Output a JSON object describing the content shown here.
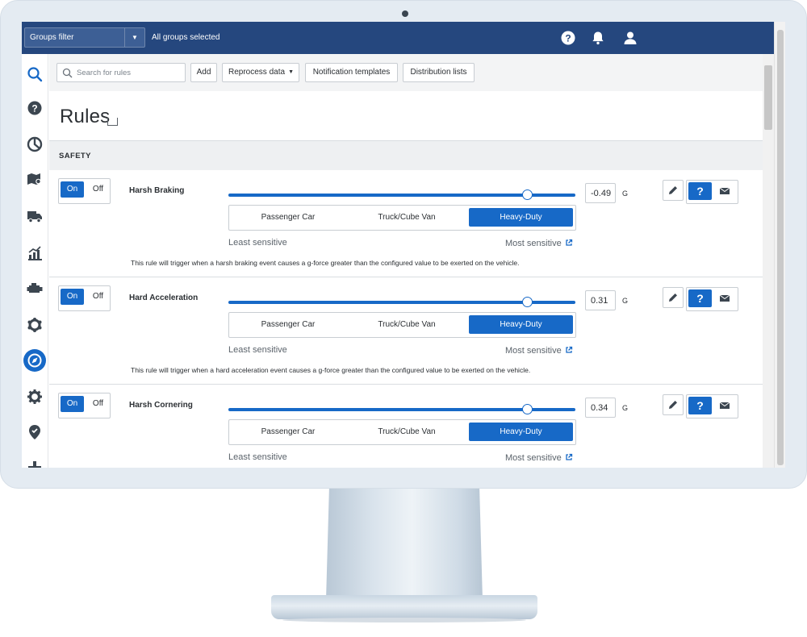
{
  "header": {
    "groups_filter_label": "Groups filter",
    "groups_status": "All groups selected"
  },
  "toolbar": {
    "search_placeholder": "Search for rules",
    "add_label": "Add",
    "reprocess_label": "Reprocess data",
    "notification_templates_label": "Notification templates",
    "distribution_lists_label": "Distribution lists"
  },
  "page": {
    "title": "Rules",
    "section_label": "SAFETY"
  },
  "vehicle_types": [
    "Passenger Car",
    "Truck/Cube Van",
    "Heavy-Duty"
  ],
  "sensitivity": {
    "least_label": "Least sensitive",
    "most_label": "Most sensitive"
  },
  "rules": [
    {
      "name": "Harsh Braking",
      "on_label": "On",
      "off_label": "Off",
      "enabled": true,
      "value": "-0.49",
      "unit": "G",
      "selected_vehicle": "Heavy-Duty",
      "slider_fraction": 0.86,
      "description": "This rule will trigger when a harsh braking event causes a g-force greater than the configured value to be exerted on the vehicle."
    },
    {
      "name": "Hard Acceleration",
      "on_label": "On",
      "off_label": "Off",
      "enabled": true,
      "value": "0.31",
      "unit": "G",
      "selected_vehicle": "Heavy-Duty",
      "slider_fraction": 0.86,
      "description": "This rule will trigger when a hard acceleration event causes a g-force greater than the configured value to be exerted on the vehicle."
    },
    {
      "name": "Harsh Cornering",
      "on_label": "On",
      "off_label": "Off",
      "enabled": true,
      "value": "0.34",
      "unit": "G",
      "selected_vehicle": "Heavy-Duty",
      "slider_fraction": 0.86,
      "description": ""
    }
  ],
  "icons": {
    "sidebar": [
      "search-icon",
      "help-circle-icon",
      "pie-chart-icon",
      "map-pin-icon",
      "truck-icon",
      "bar-chart-icon",
      "engine-icon",
      "settings-cog-icon",
      "compass-icon",
      "gear-icon",
      "location-icon",
      "plus-icon"
    ],
    "topbar": [
      "help-icon",
      "bell-icon",
      "user-icon"
    ]
  },
  "colors": {
    "topbar": "#25477e",
    "accent": "#1769c7",
    "section_bg": "#eef0f2"
  }
}
